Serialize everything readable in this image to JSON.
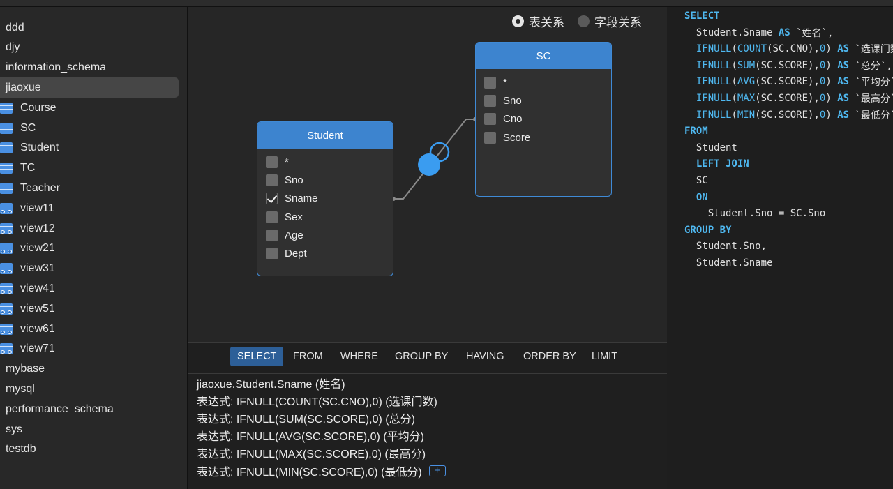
{
  "sidebar": {
    "items": [
      {
        "label": "ddd",
        "kind": "db"
      },
      {
        "label": "djy",
        "kind": "db"
      },
      {
        "label": "information_schema",
        "kind": "db"
      },
      {
        "label": "jiaoxue",
        "kind": "db",
        "selected": true
      },
      {
        "label": "Course",
        "kind": "table"
      },
      {
        "label": "SC",
        "kind": "table"
      },
      {
        "label": "Student",
        "kind": "table"
      },
      {
        "label": "TC",
        "kind": "table"
      },
      {
        "label": "Teacher",
        "kind": "table"
      },
      {
        "label": "view11",
        "kind": "view"
      },
      {
        "label": "view12",
        "kind": "view"
      },
      {
        "label": "view21",
        "kind": "view"
      },
      {
        "label": "view31",
        "kind": "view"
      },
      {
        "label": "view41",
        "kind": "view"
      },
      {
        "label": "view51",
        "kind": "view"
      },
      {
        "label": "view61",
        "kind": "view"
      },
      {
        "label": "view71",
        "kind": "view"
      },
      {
        "label": "mybase",
        "kind": "db"
      },
      {
        "label": "mysql",
        "kind": "db"
      },
      {
        "label": "performance_schema",
        "kind": "db"
      },
      {
        "label": "sys",
        "kind": "db"
      },
      {
        "label": "testdb",
        "kind": "db"
      }
    ]
  },
  "canvas": {
    "mode_options": [
      {
        "label": "表关系",
        "selected": true
      },
      {
        "label": "字段关系",
        "selected": false
      }
    ],
    "tables": [
      {
        "name": "Student",
        "fields": [
          {
            "label": "*",
            "checked": false
          },
          {
            "label": "Sno",
            "checked": false
          },
          {
            "label": "Sname",
            "checked": true
          },
          {
            "label": "Sex",
            "checked": false
          },
          {
            "label": "Age",
            "checked": false
          },
          {
            "label": "Dept",
            "checked": false
          }
        ]
      },
      {
        "name": "SC",
        "fields": [
          {
            "label": "*",
            "checked": false
          },
          {
            "label": "Sno",
            "checked": false
          },
          {
            "label": "Cno",
            "checked": false
          },
          {
            "label": "Score",
            "checked": false
          }
        ]
      }
    ]
  },
  "clause": {
    "tabs": [
      "SELECT",
      "FROM",
      "WHERE",
      "GROUP BY",
      "HAVING",
      "ORDER BY",
      "LIMIT"
    ],
    "active_tab": "SELECT",
    "lines": [
      "jiaoxue.Student.Sname  (姓名)",
      "表达式:  IFNULL(COUNT(SC.CNO),0)  (选课门数)",
      "表达式:  IFNULL(SUM(SC.SCORE),0)  (总分)",
      "表达式:  IFNULL(AVG(SC.SCORE),0)  (平均分)",
      "表达式:  IFNULL(MAX(SC.SCORE),0)  (最高分)",
      "表达式:  IFNULL(MIN(SC.SCORE),0)  (最低分)"
    ],
    "add_label": "+"
  },
  "sql": {
    "lines": [
      [
        {
          "t": "SELECT",
          "c": "kw"
        }
      ],
      [
        {
          "t": "  Student.Sname "
        },
        {
          "t": "AS",
          "c": "kw"
        },
        {
          "t": " `姓名`,"
        }
      ],
      [
        {
          "t": "  "
        },
        {
          "t": "IFNULL",
          "c": "fn"
        },
        {
          "t": "("
        },
        {
          "t": "COUNT",
          "c": "fn"
        },
        {
          "t": "(SC.CNO),"
        },
        {
          "t": "0",
          "c": "num"
        },
        {
          "t": ") "
        },
        {
          "t": "AS",
          "c": "kw"
        },
        {
          "t": " `选课门数`,"
        }
      ],
      [
        {
          "t": "  "
        },
        {
          "t": "IFNULL",
          "c": "fn"
        },
        {
          "t": "("
        },
        {
          "t": "SUM",
          "c": "fn"
        },
        {
          "t": "(SC.SCORE),"
        },
        {
          "t": "0",
          "c": "num"
        },
        {
          "t": ") "
        },
        {
          "t": "AS",
          "c": "kw"
        },
        {
          "t": " `总分`,"
        }
      ],
      [
        {
          "t": "  "
        },
        {
          "t": "IFNULL",
          "c": "fn"
        },
        {
          "t": "("
        },
        {
          "t": "AVG",
          "c": "fn"
        },
        {
          "t": "(SC.SCORE),"
        },
        {
          "t": "0",
          "c": "num"
        },
        {
          "t": ") "
        },
        {
          "t": "AS",
          "c": "kw"
        },
        {
          "t": " `平均分`,"
        }
      ],
      [
        {
          "t": "  "
        },
        {
          "t": "IFNULL",
          "c": "fn"
        },
        {
          "t": "("
        },
        {
          "t": "MAX",
          "c": "fn"
        },
        {
          "t": "(SC.SCORE),"
        },
        {
          "t": "0",
          "c": "num"
        },
        {
          "t": ") "
        },
        {
          "t": "AS",
          "c": "kw"
        },
        {
          "t": " `最高分`,"
        }
      ],
      [
        {
          "t": "  "
        },
        {
          "t": "IFNULL",
          "c": "fn"
        },
        {
          "t": "("
        },
        {
          "t": "MIN",
          "c": "fn"
        },
        {
          "t": "(SC.SCORE),"
        },
        {
          "t": "0",
          "c": "num"
        },
        {
          "t": ") "
        },
        {
          "t": "AS",
          "c": "kw"
        },
        {
          "t": " `最低分`"
        }
      ],
      [
        {
          "t": "FROM",
          "c": "kw"
        }
      ],
      [
        {
          "t": "  Student"
        }
      ],
      [
        {
          "t": "  "
        },
        {
          "t": "LEFT JOIN",
          "c": "kw"
        }
      ],
      [
        {
          "t": "  SC"
        }
      ],
      [
        {
          "t": "  "
        },
        {
          "t": "ON",
          "c": "kw"
        }
      ],
      [
        {
          "t": "    Student.Sno = SC.Sno"
        }
      ],
      [
        {
          "t": "GROUP BY",
          "c": "kw"
        }
      ],
      [
        {
          "t": "  Student.Sno,"
        }
      ],
      [
        {
          "t": "  Student.Sname"
        }
      ]
    ]
  },
  "colors": {
    "accent": "#4a90e2",
    "table_header": "#3d84cf",
    "keyword": "#4fb8f0",
    "active_tab": "#2d5f98"
  }
}
